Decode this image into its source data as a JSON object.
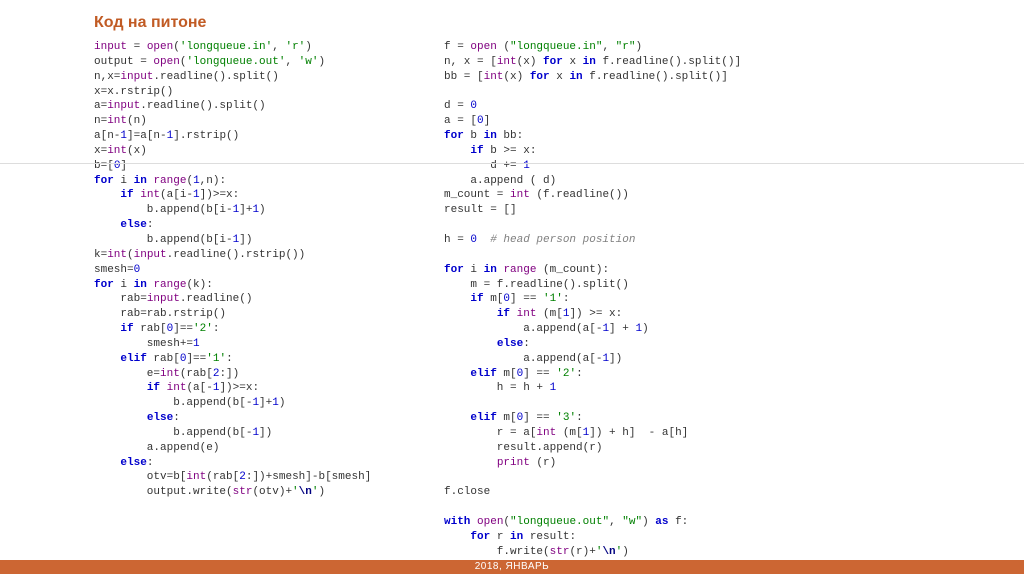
{
  "title": "Код на питоне",
  "footer": "2018, ЯНВАРЬ",
  "left": {
    "l01a": "input",
    "l01b": " = ",
    "l01c": "open",
    "l01d": "(",
    "l01e": "'longqueue.in'",
    "l01f": ", ",
    "l01g": "'r'",
    "l01h": ")",
    "l02a": "output = ",
    "l02b": "open",
    "l02c": "(",
    "l02d": "'longqueue.out'",
    "l02e": ", ",
    "l02f": "'w'",
    "l02g": ")",
    "l03a": "n,x=",
    "l03b": "input",
    "l03c": ".readline().split()",
    "l04": "x=x.rstrip()",
    "l05a": "a=",
    "l05b": "input",
    "l05c": ".readline().split()",
    "l06a": "n=",
    "l06b": "int",
    "l06c": "(n)",
    "l07a": "a[n-",
    "l07b": "1",
    "l07c": "]=a[n-",
    "l07d": "1",
    "l07e": "].rstrip()",
    "l08a": "x=",
    "l08b": "int",
    "l08c": "(x)",
    "l09a": "b=[",
    "l09b": "0",
    "l09c": "]",
    "l10a": "for",
    "l10b": " i ",
    "l10c": "in",
    "l10d": " ",
    "l10e": "range",
    "l10f": "(",
    "l10g": "1",
    "l10h": ",n):",
    "l11a": "    ",
    "l11b": "if",
    "l11c": " ",
    "l11d": "int",
    "l11e": "(a[i-",
    "l11f": "1",
    "l11g": "])>=x:",
    "l12a": "        b.append(b[i-",
    "l12b": "1",
    "l12c": "]+",
    "l12d": "1",
    "l12e": ")",
    "l13a": "    ",
    "l13b": "else",
    "l13c": ":",
    "l14a": "        b.append(b[i-",
    "l14b": "1",
    "l14c": "])",
    "l15a": "k=",
    "l15b": "int",
    "l15c": "(",
    "l15d": "input",
    "l15e": ".readline().rstrip())",
    "l16a": "smesh=",
    "l16b": "0",
    "l17a": "for",
    "l17b": " i ",
    "l17c": "in",
    "l17d": " ",
    "l17e": "range",
    "l17f": "(k):",
    "l18a": "    rab=",
    "l18b": "input",
    "l18c": ".readline()",
    "l19": "    rab=rab.rstrip()",
    "l20a": "    ",
    "l20b": "if",
    "l20c": " rab[",
    "l20d": "0",
    "l20e": "]==",
    "l20f": "'2'",
    "l20g": ":",
    "l21a": "        smesh+=",
    "l21b": "1",
    "l22a": "    ",
    "l22b": "elif",
    "l22c": " rab[",
    "l22d": "0",
    "l22e": "]==",
    "l22f": "'1'",
    "l22g": ":",
    "l23a": "        e=",
    "l23b": "int",
    "l23c": "(rab[",
    "l23d": "2",
    "l23e": ":])",
    "l24a": "        ",
    "l24b": "if",
    "l24c": " ",
    "l24d": "int",
    "l24e": "(a[-",
    "l24f": "1",
    "l24g": "])>=x:",
    "l25a": "            b.append(b[-",
    "l25b": "1",
    "l25c": "]+",
    "l25d": "1",
    "l25e": ")",
    "l26a": "        ",
    "l26b": "else",
    "l26c": ":",
    "l27a": "            b.append(b[-",
    "l27b": "1",
    "l27c": "])",
    "l28": "        a.append(e)",
    "l29a": "    ",
    "l29b": "else",
    "l29c": ":",
    "l30a": "        otv=b[",
    "l30b": "int",
    "l30c": "(rab[",
    "l30d": "2",
    "l30e": ":])+smesh]-b[smesh]",
    "l31a": "        output.write(",
    "l31b": "str",
    "l31c": "(otv)+",
    "l31d": "'",
    "l31e": "\\n",
    "l31f": "'",
    "l31g": ")"
  },
  "right": {
    "r01a": "f = ",
    "r01b": "open",
    "r01c": " (",
    "r01d": "\"longqueue.in\"",
    "r01e": ", ",
    "r01f": "\"r\"",
    "r01g": ")",
    "r02a": "n, x = [",
    "r02b": "int",
    "r02c": "(x) ",
    "r02d": "for",
    "r02e": " x ",
    "r02f": "in",
    "r02g": " f.readline().split()]",
    "r03a": "bb = [",
    "r03b": "int",
    "r03c": "(x) ",
    "r03d": "for",
    "r03e": " x ",
    "r03f": "in",
    "r03g": " f.readline().split()]",
    "r04": "",
    "r05a": "d = ",
    "r05b": "0",
    "r06a": "a = [",
    "r06b": "0",
    "r06c": "]",
    "r07a": "for",
    "r07b": " b ",
    "r07c": "in",
    "r07d": " bb:",
    "r08a": "    ",
    "r08b": "if",
    "r08c": " b >= x:",
    "r09a": "       d += ",
    "r09b": "1",
    "r10": "    a.append ( d)",
    "r11a": "m_count = ",
    "r11b": "int",
    "r11c": " (f.readline())",
    "r12": "result = []",
    "r13": "",
    "r14a": "h = ",
    "r14b": "0",
    "r14c": "  ",
    "r14d": "# head person position",
    "r15": "",
    "r16a": "for",
    "r16b": " i ",
    "r16c": "in",
    "r16d": " ",
    "r16e": "range",
    "r16f": " (m_count):",
    "r17": "    m = f.readline().split()",
    "r18a": "    ",
    "r18b": "if",
    "r18c": " m[",
    "r18d": "0",
    "r18e": "] == ",
    "r18f": "'1'",
    "r18g": ":",
    "r19a": "        ",
    "r19b": "if",
    "r19c": " ",
    "r19d": "int",
    "r19e": " (m[",
    "r19f": "1",
    "r19g": "]) >= x:",
    "r20a": "            a.append(a[-",
    "r20b": "1",
    "r20c": "] + ",
    "r20d": "1",
    "r20e": ")",
    "r21a": "        ",
    "r21b": "else",
    "r21c": ":",
    "r22a": "            a.append(a[-",
    "r22b": "1",
    "r22c": "])",
    "r23a": "    ",
    "r23b": "elif",
    "r23c": " m[",
    "r23d": "0",
    "r23e": "] == ",
    "r23f": "'2'",
    "r23g": ":",
    "r24a": "        h = h + ",
    "r24b": "1",
    "r25": "",
    "r26a": "    ",
    "r26b": "elif",
    "r26c": " m[",
    "r26d": "0",
    "r26e": "] == ",
    "r26f": "'3'",
    "r26g": ":",
    "r27a": "        r = a[",
    "r27b": "int",
    "r27c": " (m[",
    "r27d": "1",
    "r27e": "]) + h]  - a[h]",
    "r28": "        result.append(r)",
    "r29a": "        ",
    "r29b": "print",
    "r29c": " (r)",
    "r30": "",
    "r31": "f.close",
    "r32": "",
    "r33a": "with",
    "r33b": " ",
    "r33c": "open",
    "r33d": "(",
    "r33e": "\"longqueue.out\"",
    "r33f": ", ",
    "r33g": "\"w\"",
    "r33h": ") ",
    "r33i": "as",
    "r33j": " f:",
    "r34a": "    ",
    "r34b": "for",
    "r34c": " r ",
    "r34d": "in",
    "r34e": " result:",
    "r35a": "        f.write(",
    "r35b": "str",
    "r35c": "(r)+",
    "r35d": "'",
    "r35e": "\\n",
    "r35f": "'",
    "r35g": ")"
  }
}
